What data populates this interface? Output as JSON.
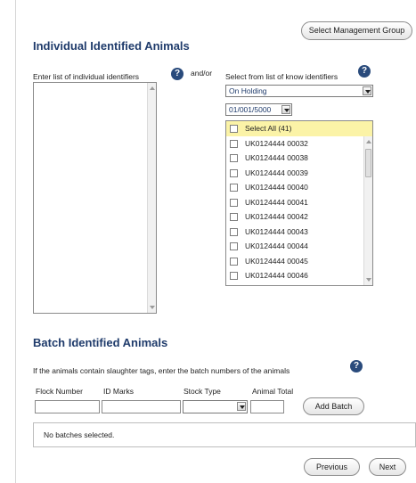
{
  "header": {
    "select_group_label": "Select Management Group"
  },
  "individual": {
    "title": "Individual Identified Animals",
    "enter_list_label": "Enter list of individual identifiers",
    "andor": "and/or",
    "select_from_label": "Select from list of know identifiers",
    "holding_value": "On Holding",
    "code_value": "01/001/5000",
    "select_all_label": "Select All (41)",
    "identifiers": [
      "UK0124444 00032",
      "UK0124444 00038",
      "UK0124444 00039",
      "UK0124444 00040",
      "UK0124444 00041",
      "UK0124444 00042",
      "UK0124444 00043",
      "UK0124444 00044",
      "UK0124444 00045",
      "UK0124444 00046"
    ]
  },
  "batch": {
    "title": "Batch Identified Animals",
    "instruction": "If the animals contain slaughter tags, enter the batch numbers of the animals",
    "col_flock": "Flock Number",
    "col_id_marks": "ID Marks",
    "col_stock_type": "Stock Type",
    "col_animal_total": "Animal Total",
    "add_batch_label": "Add Batch",
    "empty_message": "No batches selected."
  },
  "footer": {
    "previous_label": "Previous",
    "next_label": "Next"
  }
}
